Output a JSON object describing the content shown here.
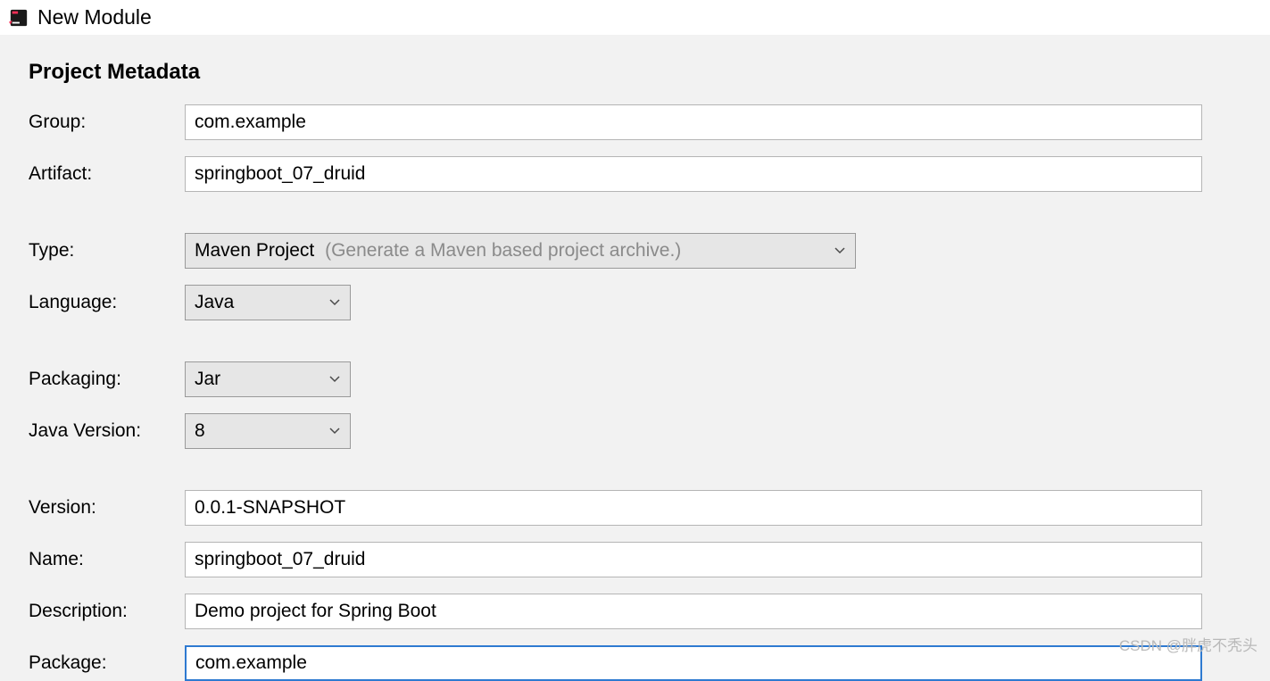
{
  "window": {
    "title": "New Module"
  },
  "section": {
    "title": "Project Metadata"
  },
  "labels": {
    "group": "Group:",
    "artifact": "Artifact:",
    "type": "Type:",
    "language": "Language:",
    "packaging": "Packaging:",
    "javaVersion": "Java Version:",
    "version": "Version:",
    "name": "Name:",
    "description": "Description:",
    "package": "Package:"
  },
  "values": {
    "group": "com.example",
    "artifact": "springboot_07_druid",
    "type": "Maven Project",
    "typeHint": "(Generate a Maven based project archive.)",
    "language": "Java",
    "packaging": "Jar",
    "javaVersion": "8",
    "version": "0.0.1-SNAPSHOT",
    "name": "springboot_07_druid",
    "description": "Demo project for Spring Boot",
    "package": "com.example"
  },
  "watermark": "CSDN @胖虎不秃头"
}
